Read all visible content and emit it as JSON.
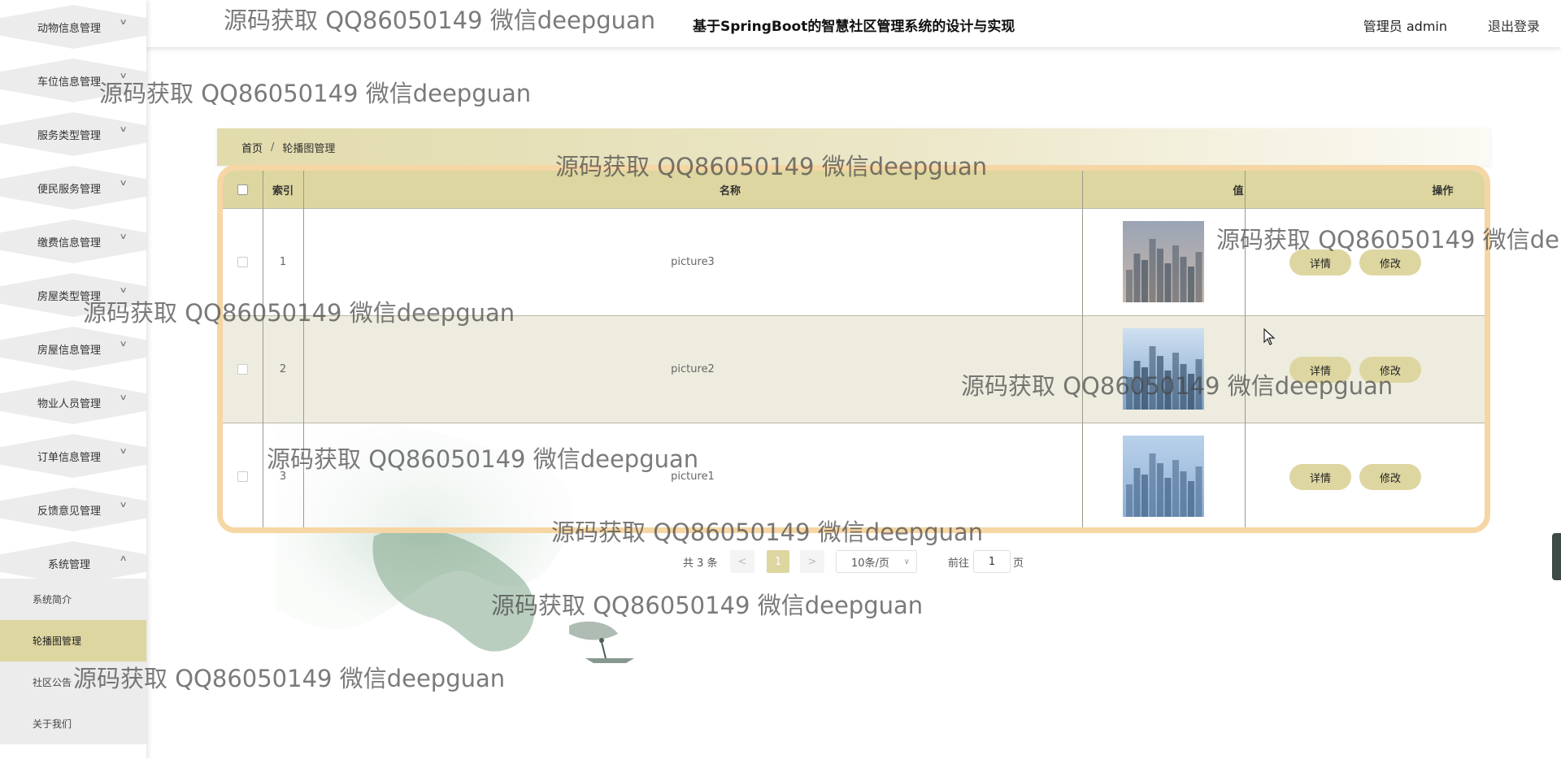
{
  "header": {
    "title": "基于SpringBoot的智慧社区管理系统的设计与实现",
    "user": "管理员 admin",
    "logout": "退出登录"
  },
  "sidebar": {
    "items": [
      {
        "label": "动物信息管理",
        "expanded": false
      },
      {
        "label": "车位信息管理",
        "expanded": false
      },
      {
        "label": "服务类型管理",
        "expanded": false
      },
      {
        "label": "便民服务管理",
        "expanded": false
      },
      {
        "label": "缴费信息管理",
        "expanded": false
      },
      {
        "label": "房屋类型管理",
        "expanded": false
      },
      {
        "label": "房屋信息管理",
        "expanded": false
      },
      {
        "label": "物业人员管理",
        "expanded": false
      },
      {
        "label": "订单信息管理",
        "expanded": false
      },
      {
        "label": "反馈意见管理",
        "expanded": false
      },
      {
        "label": "系统管理",
        "expanded": true
      }
    ],
    "submenu": [
      {
        "label": "系统简介",
        "active": false
      },
      {
        "label": "轮播图管理",
        "active": true
      },
      {
        "label": "社区公告",
        "active": false
      },
      {
        "label": "关于我们",
        "active": false
      }
    ]
  },
  "breadcrumb": {
    "home": "首页",
    "separator": "/",
    "current": "轮播图管理"
  },
  "table": {
    "columns": [
      "索引",
      "名称",
      "值",
      "操作"
    ],
    "rows": [
      {
        "index": "1",
        "name": "picture3",
        "image": "city-skyline-dusk"
      },
      {
        "index": "2",
        "name": "picture2",
        "image": "city-skyline-blue"
      },
      {
        "index": "3",
        "name": "picture1",
        "image": "city-skyline-haze"
      }
    ],
    "actions": {
      "detail": "详情",
      "edit": "修改"
    }
  },
  "pagination": {
    "total": "共 3 条",
    "prev": "<",
    "next": ">",
    "current_page": "1",
    "page_size": "10条/页",
    "goto_prefix": "前往",
    "goto_value": "1",
    "goto_suffix": "页"
  },
  "watermark": {
    "text": "源码获取 QQ86050149 微信deepguan",
    "text_partial": "源码获取 QQ86050149 微信de"
  },
  "colors": {
    "accent": "#ddd6a0",
    "table_border": "#f6d6a4",
    "sidebar_item": "#ececec"
  }
}
